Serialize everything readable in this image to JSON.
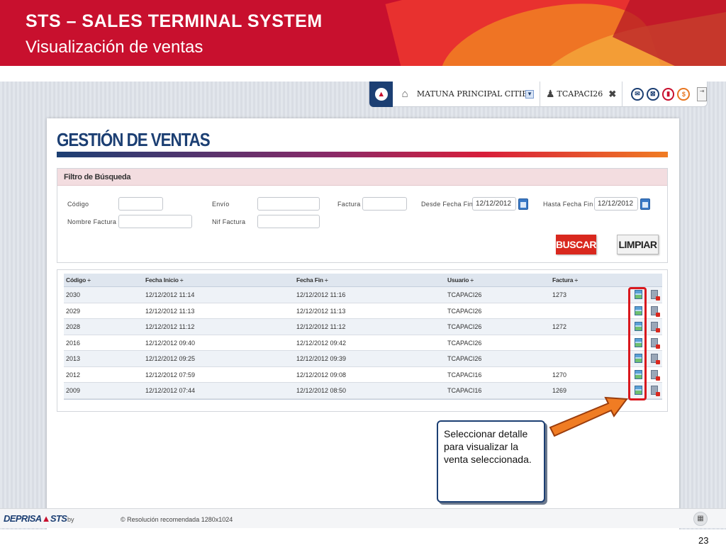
{
  "slide": {
    "title": "STS – SALES  TERMINAL SYSTEM",
    "subtitle": "Visualización de ventas",
    "page_number": "23"
  },
  "topbar": {
    "branch": "MATUNA PRINCIPAL CITIBAN",
    "user": "TCAPACI26"
  },
  "page": {
    "title": "GESTIÓN DE VENTAS"
  },
  "filter": {
    "header": "Filtro de Búsqueda",
    "codigo_label": "Código",
    "envio_label": "Envío",
    "factura_label": "Factura",
    "desde_label": "Desde Fecha Fin",
    "desde_value": "12/12/2012",
    "hasta_label": "Hasta Fecha Fin",
    "hasta_value": "12/12/2012",
    "nombre_factura_label": "Nombre Factura",
    "nif_factura_label": "Nif Factura",
    "buscar_label": "BUSCAR",
    "limpiar_label": "LIMPIAR"
  },
  "grid": {
    "columns": [
      "Código ÷",
      "Fecha Inicio ÷",
      "Fecha Fin ÷",
      "Usuario ÷",
      "Factura ÷"
    ],
    "rows": [
      [
        "2030",
        "12/12/2012 11:14",
        "12/12/2012 11:16",
        "TCAPACI26",
        "1273"
      ],
      [
        "2029",
        "12/12/2012 11:13",
        "12/12/2012 11:13",
        "TCAPACI26",
        ""
      ],
      [
        "2028",
        "12/12/2012 11:12",
        "12/12/2012 11:12",
        "TCAPACI26",
        "1272"
      ],
      [
        "2016",
        "12/12/2012 09:40",
        "12/12/2012 09:42",
        "TCAPACI26",
        ""
      ],
      [
        "2013",
        "12/12/2012 09:25",
        "12/12/2012 09:39",
        "TCAPACI26",
        ""
      ],
      [
        "2012",
        "12/12/2012 07:59",
        "12/12/2012 09:08",
        "TCAPACI16",
        "1270"
      ],
      [
        "2009",
        "12/12/2012 07:44",
        "12/12/2012 08:50",
        "TCAPACI16",
        "1269"
      ]
    ]
  },
  "callout": {
    "text": "Seleccionar detalle para visualizar la venta seleccionada."
  },
  "footer": {
    "brand_a": "DEPRISA",
    "brand_b": "STS",
    "by": "by",
    "resolution": "© Resolución recomendada 1280x1024"
  },
  "icons": [
    "home-icon",
    "user-icon",
    "close-icon",
    "detail-icon",
    "delete-icon",
    "calendar-icon"
  ]
}
